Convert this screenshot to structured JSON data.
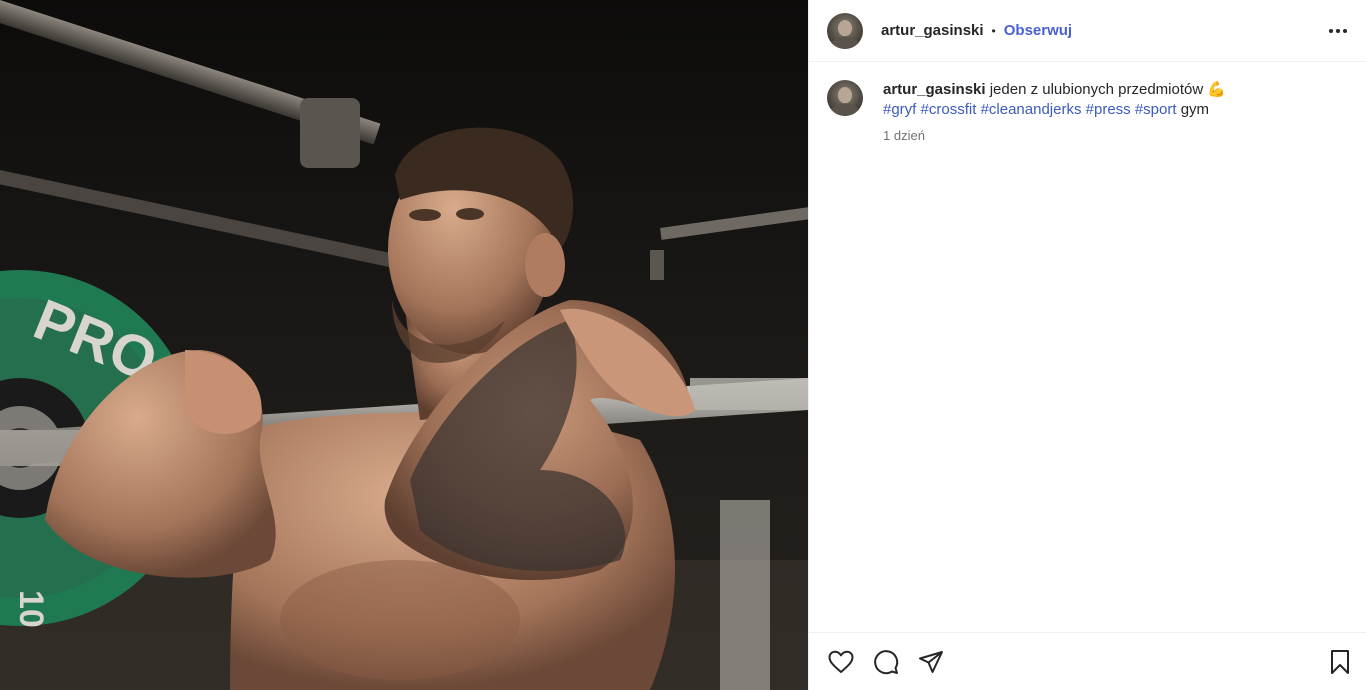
{
  "post": {
    "photo": {
      "plate_text": "PRO",
      "plate_text_2": "10",
      "plate_color": "#1f7a52"
    },
    "header": {
      "username": "artur_gasinski",
      "separator": "•",
      "follow_label": "Obserwuj",
      "more_icon": "more-horizontal-icon"
    },
    "caption": {
      "username": "artur_gasinski",
      "text": "jeden z ulubionych przedmiotów",
      "emoji": "💪",
      "hashtags": [
        "#gryf",
        "#crossfit",
        "#cleanandjerks",
        "#press",
        "#sport"
      ],
      "trailing_text": "gym",
      "time": "1 dzień"
    },
    "actions": {
      "like_icon": "heart-icon",
      "comment_icon": "comment-icon",
      "share_icon": "send-icon",
      "save_icon": "bookmark-icon"
    },
    "colors": {
      "follow": "#4a5fd4",
      "hashtag": "#3c5bc1",
      "text": "#262626",
      "muted": "#737373"
    }
  }
}
